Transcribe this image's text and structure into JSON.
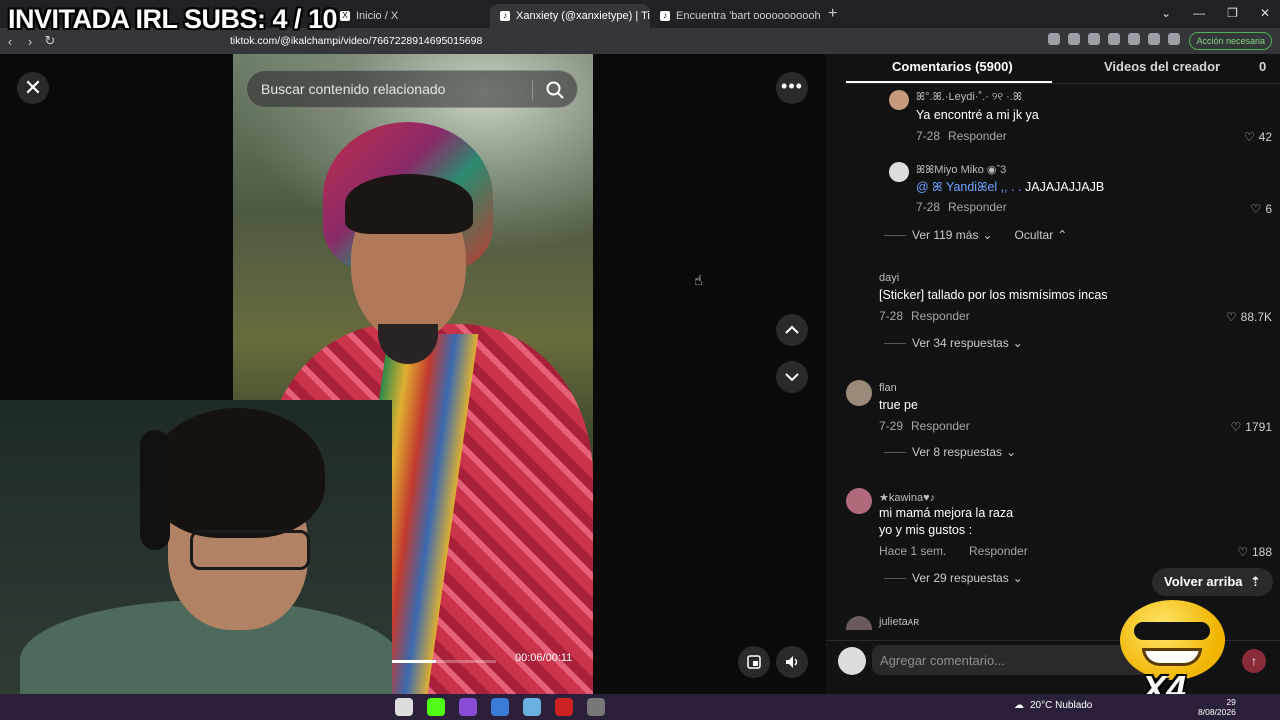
{
  "overlay": {
    "stream_title": "INVITADA IRL SUBS: 4 / 10",
    "badge_text": "X4"
  },
  "browser": {
    "tabs": [
      {
        "label": "Inicio / X",
        "active": false
      },
      {
        "label": "Xanxiety (@xanxietype) | TikT...",
        "active": true
      },
      {
        "label": "Encuentra 'bart ooooooooooh ooooo...",
        "active": false
      }
    ],
    "url": "tiktok.com/@ikalchampi/video/7667228914695015698",
    "action_badge": "Acción necesaria"
  },
  "video": {
    "search_placeholder": "Buscar contenido relacionado",
    "time": "00:06/00:11",
    "progress_fraction": 0.5
  },
  "panel": {
    "tabs": [
      {
        "label": "Comentarios (5900)",
        "active": true
      },
      {
        "label": "Videos del creador",
        "active": false
      }
    ],
    "tab_counter": "0",
    "reply_label": "Responder",
    "comments": [
      {
        "user": "ꕤ°.ꕤ.·Leydi·˚.· ୨୧ ·.ꕤ",
        "text": "Ya encontré a mi jk ya",
        "date": "7-28",
        "likes": "42"
      },
      {
        "user": "ꕤꕤMiyo Miko ◉ˆ3",
        "text_mention": "@ ꕤ Yandiꕤel ,, . . ",
        "text": "JAJAJAJJAJB",
        "date": "7-28",
        "likes": "6"
      },
      {
        "user": "dayi",
        "text": "[Sticker] tallado por los mismísimos incas",
        "date": "7-28",
        "likes": "88.7K"
      },
      {
        "user": "flan",
        "text": "true pe",
        "date": "7-29",
        "likes": "1791"
      },
      {
        "user": "★kawina♥♪",
        "text": "mi mamá mejora la raza",
        "text2": "yo y mis gustos :",
        "date": "Hace 1 sem.",
        "likes": "188"
      },
      {
        "user": "julietaᴀʀ"
      }
    ],
    "thread_more_1": "Ver 119 más",
    "thread_hide": "Ocultar",
    "thread_more_2": "Ver 34 respuestas",
    "thread_more_3": "Ver 8 respuestas",
    "thread_more_4": "Ver 29 respuestas",
    "back_to_top": "Volver arriba",
    "add_comment_placeholder": "Agregar comentario..."
  },
  "taskbar": {
    "weather": "20°C  Nublado",
    "time": "29",
    "date": "8/08/2026"
  }
}
